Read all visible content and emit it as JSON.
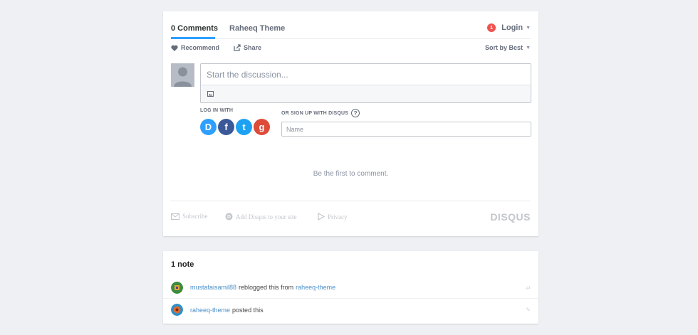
{
  "disqus": {
    "tabs": {
      "comments": "0 Comments",
      "community": "Raheeq Theme"
    },
    "login": {
      "badge": "1",
      "label": "Login"
    },
    "subnav": {
      "recommend": "Recommend",
      "share": "Share",
      "sort": "Sort by Best"
    },
    "composer": {
      "placeholder": "Start the discussion..."
    },
    "login_with": "LOG IN WITH",
    "social": [
      {
        "icon": "disqus-icon",
        "glyph": "D",
        "color": "#2e9fff"
      },
      {
        "icon": "facebook-icon",
        "glyph": "f",
        "color": "#3b5998"
      },
      {
        "icon": "twitter-icon",
        "glyph": "t",
        "color": "#1da1f2"
      },
      {
        "icon": "google-icon",
        "glyph": "g",
        "color": "#dd4b39"
      }
    ],
    "signup": {
      "label": "OR SIGN UP WITH DISQUS",
      "help": "?"
    },
    "name_field": {
      "placeholder": "Name"
    },
    "empty_message": "Be the first to comment.",
    "footer": {
      "subscribe": "Subscribe",
      "add_disqus": "Add Disqus to your site",
      "privacy": "Privacy",
      "logo": "DISQUS"
    }
  },
  "notes": {
    "title": "1 note",
    "rows": [
      {
        "user": "mustafaisamil88",
        "action": "reblogged this from",
        "target": "raheeq-theme"
      },
      {
        "user": "raheeq-theme",
        "action": "posted this"
      }
    ]
  },
  "colors": {
    "accent": "#2e9fff",
    "badge": "#ef5350",
    "link": "#4a90c8",
    "background": "#eef0f4"
  }
}
